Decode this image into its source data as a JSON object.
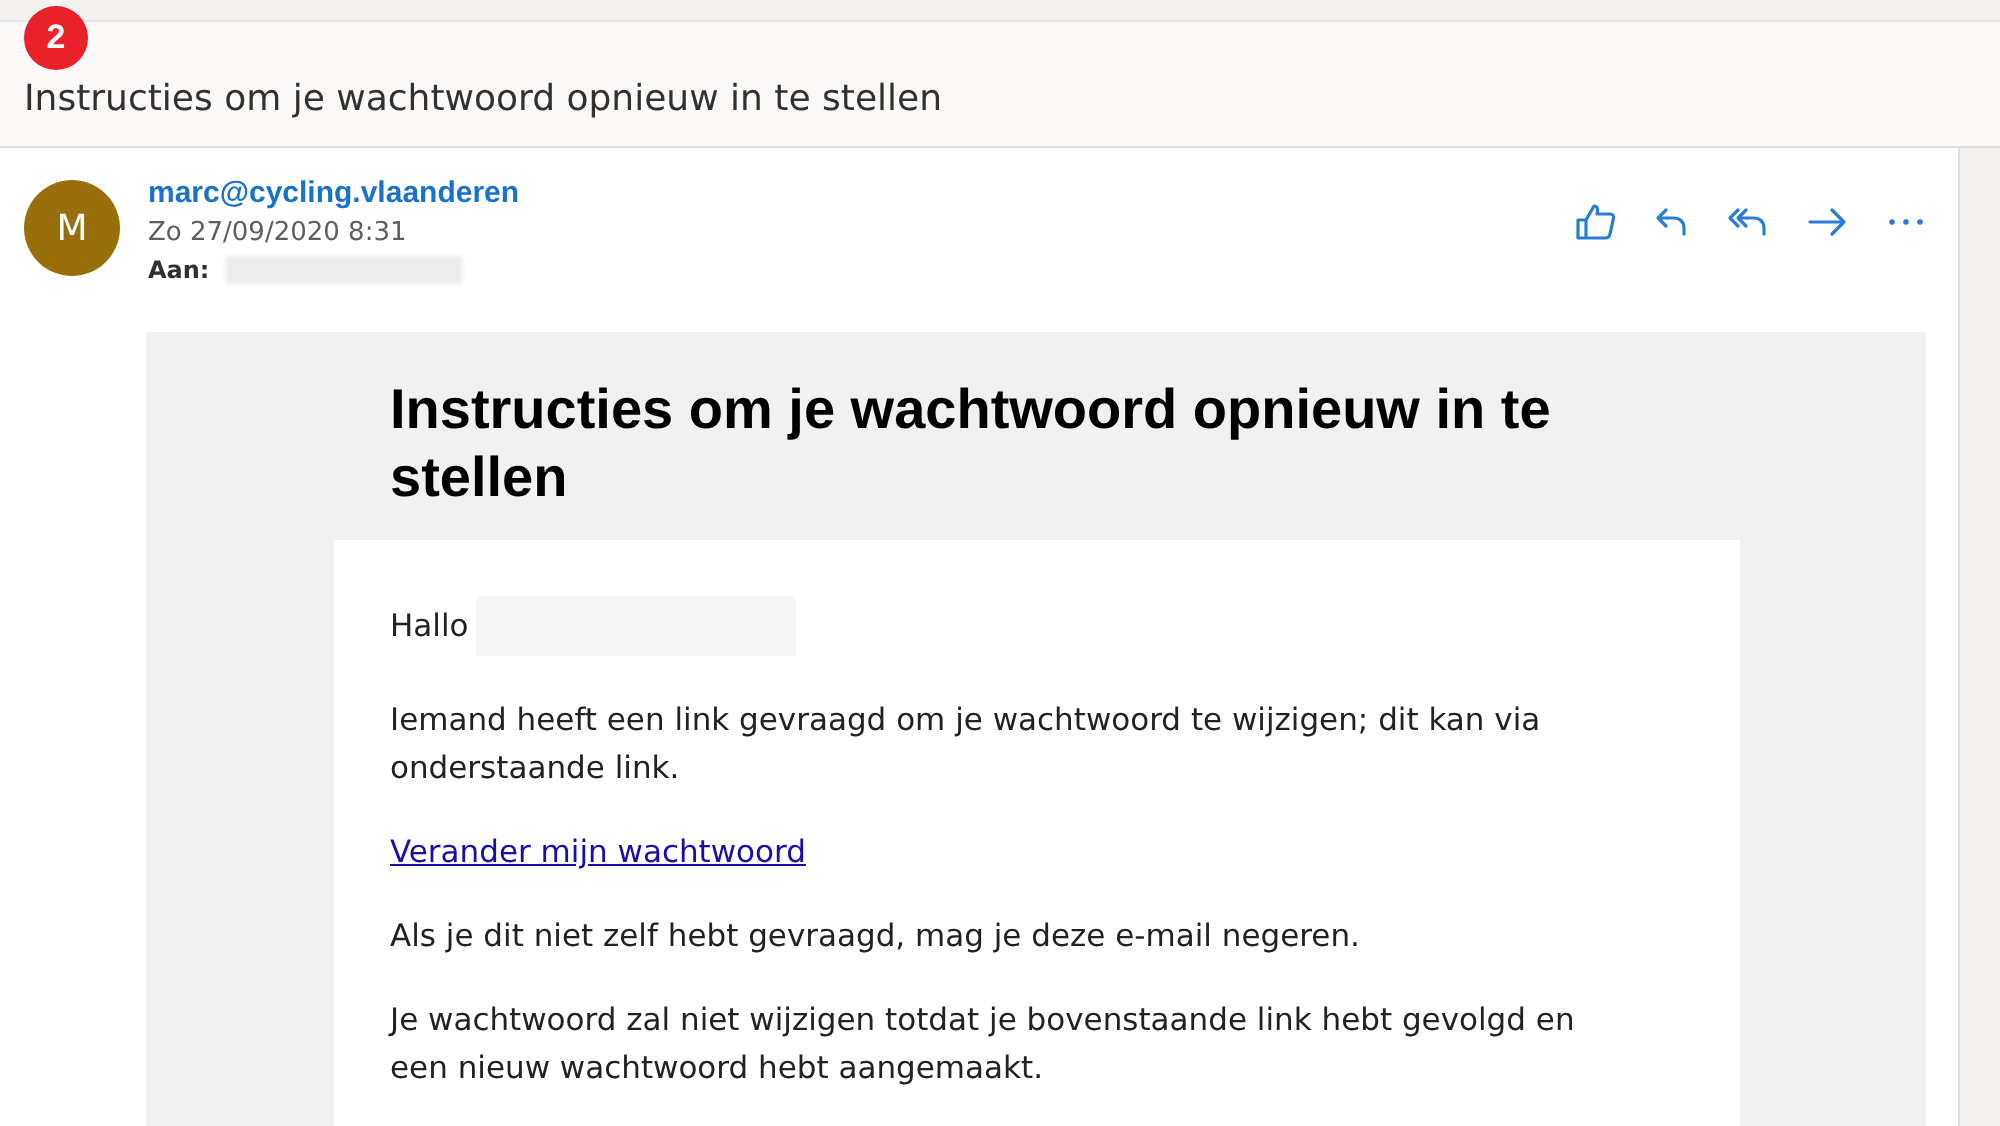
{
  "badge": "2",
  "subject": "Instructies om je wachtwoord opnieuw in te stellen",
  "sender": {
    "avatar": "M",
    "email": "marc@cycling.vlaanderen",
    "date": "Zo 27/09/2020 8:31",
    "to_label": "Aan:"
  },
  "actions": [
    {
      "kind": "like"
    },
    {
      "kind": "reply"
    },
    {
      "kind": "reply_all"
    },
    {
      "kind": "forward"
    },
    {
      "kind": "more"
    }
  ],
  "body": {
    "heading": "Instructies om je wachtwoord opnieuw in te stellen",
    "greeting": "Hallo",
    "paragraphs": [
      {
        "kind": "text",
        "text": "Iemand heeft een link gevraagd om je wachtwoord te wijzigen; dit kan via onderstaande link."
      },
      {
        "kind": "link",
        "text": "Verander mijn wachtwoord"
      },
      {
        "kind": "text",
        "text": "Als je dit niet zelf hebt gevraagd, mag je deze e-mail negeren."
      },
      {
        "kind": "text",
        "text": "Je wachtwoord zal niet wijzigen totdat je bovenstaande link hebt gevolgd en een nieuw wachtwoord hebt aangemaakt."
      }
    ]
  }
}
